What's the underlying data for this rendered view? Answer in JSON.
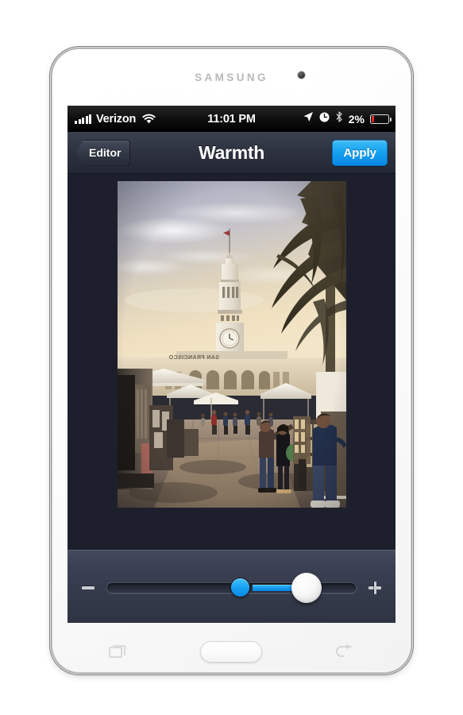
{
  "device": {
    "brand_label": "SAMSUNG",
    "camera_icon": "front-camera-dot"
  },
  "status_bar": {
    "carrier": "Verizon",
    "signal_icon": "signal-bars-icon",
    "wifi_icon": "wifi-icon",
    "time": "11:01 PM",
    "location_icon": "location-arrow-icon",
    "alarm_icon": "alarm-clock-icon",
    "bluetooth_icon": "bluetooth-icon",
    "battery_percent": "2%",
    "battery_icon": "battery-low-icon",
    "battery_color": "#e2231a"
  },
  "nav_bar": {
    "back_label": "Editor",
    "title": "Warmth",
    "apply_label": "Apply",
    "apply_color": "#15a1f0"
  },
  "canvas": {
    "photo_alt": "San Francisco Ferry Building clock tower above an outdoor farmers market with palm trees",
    "background_color": "#1d202c"
  },
  "slider": {
    "minus_icon": "minus-icon",
    "plus_icon": "plus-icon",
    "center_anchor_icon": "slider-center-anchor",
    "thumb_icon": "slider-thumb",
    "fill_color": "#1098ee",
    "value_position_percent": 80,
    "center_position_percent": 53.5
  },
  "soft_keys": {
    "recent_icon": "recent-apps-icon",
    "home_icon": "home-button",
    "back_icon": "back-arrow-icon"
  }
}
